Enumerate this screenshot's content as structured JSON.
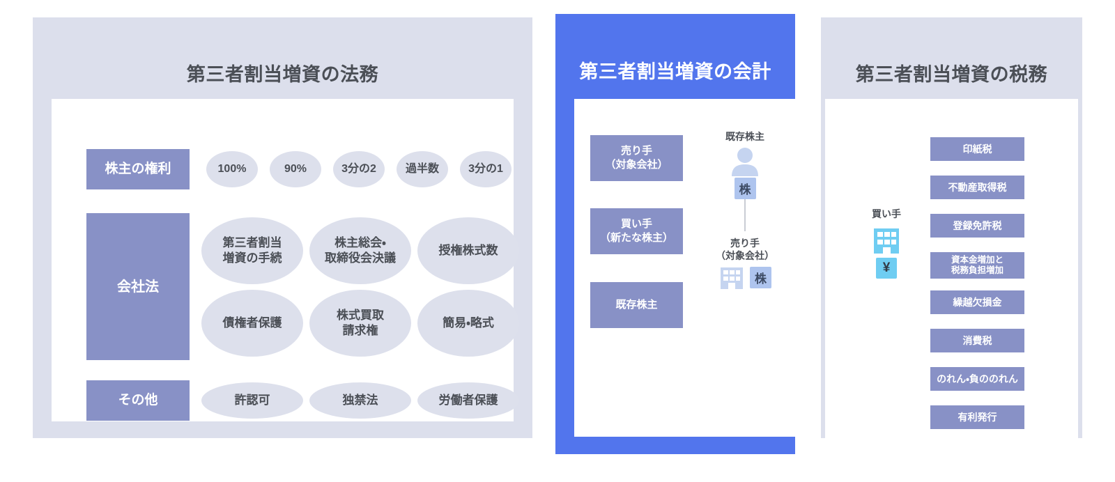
{
  "panels": {
    "legal": {
      "title": "第三者割当増資の法務",
      "rows": [
        {
          "category": "株主の権利",
          "items": [
            "100%",
            "90%",
            "3分の2",
            "過半数",
            "3分の1"
          ]
        },
        {
          "category": "会社法",
          "items": [
            "第三者割当\n増資の手続",
            "株主総会・\n取締役会決議",
            "授権株式数",
            "債権者保護",
            "株式買取\n請求権",
            "簡易・略式"
          ]
        },
        {
          "category": "その他",
          "items": [
            "許認可",
            "独禁法",
            "労働者保護"
          ]
        }
      ]
    },
    "accounting": {
      "title": "第三者割当増資の会計",
      "highlighted": true,
      "boxes": [
        "売り手\n（対象会社）",
        "買い手\n（新たな株主）",
        "既存株主"
      ],
      "diagram": {
        "top_label": "既存株主",
        "top_icon": "person-icon",
        "top_badge": "株",
        "bottom_label": "売り手\n（対象会社）",
        "bottom_icon": "building-icon",
        "bottom_badge": "株"
      }
    },
    "tax": {
      "title": "第三者割当増資の税務",
      "buyer": {
        "label": "買い手",
        "icon": "building-icon",
        "badge": "¥"
      },
      "items": [
        "印紙税",
        "不動産取得税",
        "登録免許税",
        "資本金増加と\n税務負担増加",
        "繰越欠損金",
        "消費税",
        "のれん・負ののれん",
        "有利発行"
      ]
    }
  },
  "colors": {
    "panel_bg": "#dcdfec",
    "panel_highlight_bg": "#5275ed",
    "category_box": "#8891c6",
    "ellipse": "#dde0ec",
    "text_dark": "#4b4f56",
    "icon_periwinkle": "#c5d4f0",
    "icon_cyan": "#6fcdf2",
    "badge_blue": "#aec4ee"
  }
}
